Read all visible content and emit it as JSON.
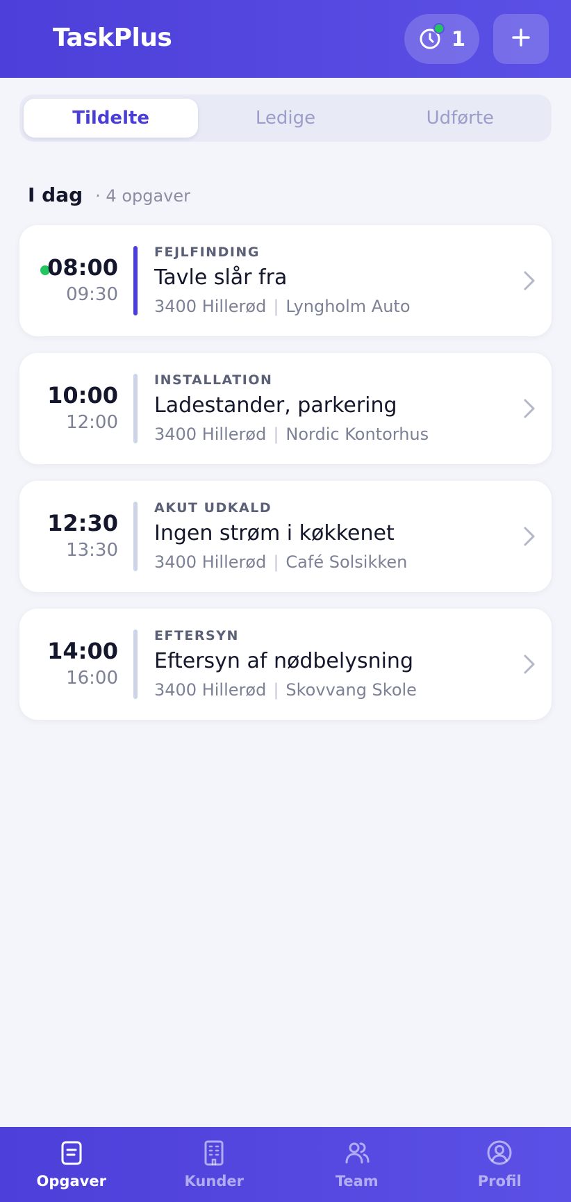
{
  "header": {
    "app_title": "TaskPlus",
    "timer_count": "1",
    "icons": {
      "timer": "clock-icon",
      "add": "plus-icon"
    }
  },
  "tabs": [
    {
      "label": "Tildelte",
      "active": true
    },
    {
      "label": "Ledige",
      "active": false
    },
    {
      "label": "Udførte",
      "active": false
    }
  ],
  "section": {
    "title": "I dag",
    "count_text": "· 4 opgaver"
  },
  "tasks": [
    {
      "start": "08:00",
      "end": "09:30",
      "category": "FEJLFINDING",
      "title": "Tavle slår fra",
      "postal": "3400 Hillerød",
      "customer": "Lyngholm Auto",
      "active": true
    },
    {
      "start": "10:00",
      "end": "12:00",
      "category": "INSTALLATION",
      "title": "Ladestander, parkering",
      "postal": "3400 Hillerød",
      "customer": "Nordic Kontorhus",
      "active": false
    },
    {
      "start": "12:30",
      "end": "13:30",
      "category": "AKUT UDKALD",
      "title": "Ingen strøm i køkkenet",
      "postal": "3400 Hillerød",
      "customer": "Café Solsikken",
      "active": false
    },
    {
      "start": "14:00",
      "end": "16:00",
      "category": "EFTERSYN",
      "title": "Eftersyn af nødbelysning",
      "postal": "3400 Hillerød",
      "customer": "Skovvang Skole",
      "active": false
    }
  ],
  "bottom_nav": [
    {
      "label": "Opgaver",
      "icon": "clipboard-icon",
      "active": true
    },
    {
      "label": "Kunder",
      "icon": "building-icon",
      "active": false
    },
    {
      "label": "Team",
      "icon": "users-icon",
      "active": false
    },
    {
      "label": "Profil",
      "icon": "user-circle-icon",
      "active": false
    }
  ],
  "colors": {
    "brand": "#4d3fd9",
    "active_tab_text": "#4a3ed6",
    "live_indicator": "#22c55e",
    "background": "#f4f5fa"
  }
}
